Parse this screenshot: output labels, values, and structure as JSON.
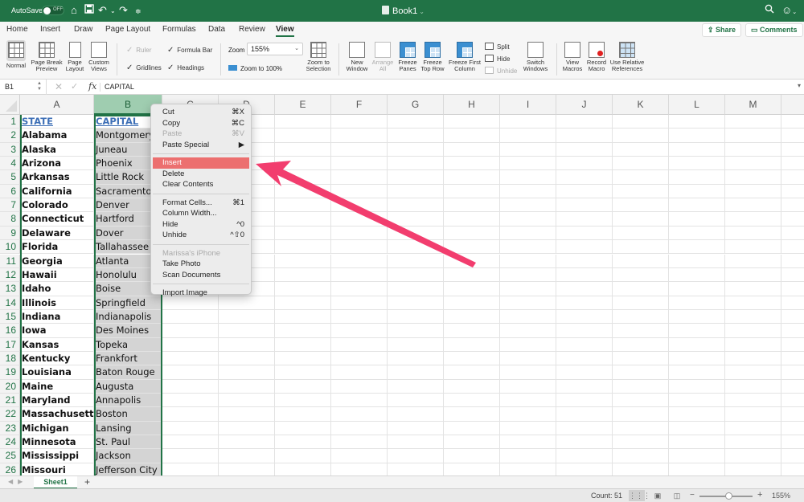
{
  "titlebar": {
    "autosave_label": "AutoSave",
    "autosave_state": "OFF",
    "doc_title": "Book1",
    "icons": [
      "home-icon",
      "save-icon",
      "undo-icon",
      "undo-dropdown-icon",
      "redo-icon",
      "customize-icon",
      "search-icon",
      "account-icon"
    ]
  },
  "tabs": [
    {
      "label": "Home",
      "active": false
    },
    {
      "label": "Insert",
      "active": false
    },
    {
      "label": "Draw",
      "active": false
    },
    {
      "label": "Page Layout",
      "active": false
    },
    {
      "label": "Formulas",
      "active": false
    },
    {
      "label": "Data",
      "active": false
    },
    {
      "label": "Review",
      "active": false
    },
    {
      "label": "View",
      "active": true
    }
  ],
  "share_label": "Share",
  "comments_label": "Comments",
  "ribbon": {
    "views": [
      {
        "label1": "Normal",
        "label2": "",
        "selected": true
      },
      {
        "label1": "Page Break",
        "label2": "Preview"
      },
      {
        "label1": "Page",
        "label2": "Layout"
      },
      {
        "label1": "Custom",
        "label2": "Views"
      }
    ],
    "show": {
      "ruler": {
        "label": "Ruler",
        "checked": true,
        "disabled": true
      },
      "formula_bar": {
        "label": "Formula Bar",
        "checked": true
      },
      "gridlines": {
        "label": "Gridlines",
        "checked": true
      },
      "headings": {
        "label": "Headings",
        "checked": true
      }
    },
    "zoom_label": "Zoom",
    "zoom_value": "155%",
    "zoom_100_label": "Zoom to 100%",
    "zoom_selection": {
      "label1": "Zoom to",
      "label2": "Selection"
    },
    "window": [
      {
        "label1": "New",
        "label2": "Window"
      },
      {
        "label1": "Arrange",
        "label2": "All",
        "disabled": true
      },
      {
        "label1": "Freeze",
        "label2": "Panes"
      },
      {
        "label1": "Freeze",
        "label2": "Top Row"
      },
      {
        "label1": "Freeze First",
        "label2": "Column"
      }
    ],
    "split_label": "Split",
    "hide_label": "Hide",
    "unhide_label": "Unhide",
    "switch_windows": {
      "label1": "Switch",
      "label2": "Windows"
    },
    "macros": [
      {
        "label1": "View",
        "label2": "Macros"
      },
      {
        "label1": "Record",
        "label2": "Macro"
      },
      {
        "label1": "Use Relative",
        "label2": "References"
      }
    ]
  },
  "formula_bar": {
    "name_box": "B1",
    "fx": "fx",
    "value": "CAPITAL"
  },
  "columns": [
    "A",
    "B",
    "C",
    "D",
    "E",
    "F",
    "G",
    "H",
    "I",
    "J",
    "K",
    "L",
    "M"
  ],
  "rows": [
    {
      "n": "1",
      "a": "STATE",
      "b": "CAPITAL"
    },
    {
      "n": "2",
      "a": "Alabama",
      "b": "Montgomery"
    },
    {
      "n": "3",
      "a": "Alaska",
      "b": "Juneau"
    },
    {
      "n": "4",
      "a": "Arizona",
      "b": "Phoenix"
    },
    {
      "n": "5",
      "a": "Arkansas",
      "b": "Little Rock"
    },
    {
      "n": "6",
      "a": "California",
      "b": "Sacramento"
    },
    {
      "n": "7",
      "a": "Colorado",
      "b": "Denver"
    },
    {
      "n": "8",
      "a": "Connecticut",
      "b": "Hartford"
    },
    {
      "n": "9",
      "a": "Delaware",
      "b": "Dover"
    },
    {
      "n": "10",
      "a": "Florida",
      "b": "Tallahassee"
    },
    {
      "n": "11",
      "a": "Georgia",
      "b": "Atlanta"
    },
    {
      "n": "12",
      "a": "Hawaii",
      "b": "Honolulu"
    },
    {
      "n": "13",
      "a": "Idaho",
      "b": "Boise"
    },
    {
      "n": "14",
      "a": "Illinois",
      "b": "Springfield"
    },
    {
      "n": "15",
      "a": "Indiana",
      "b": "Indianapolis"
    },
    {
      "n": "16",
      "a": "Iowa",
      "b": "Des Moines"
    },
    {
      "n": "17",
      "a": "Kansas",
      "b": "Topeka"
    },
    {
      "n": "18",
      "a": "Kentucky",
      "b": "Frankfort"
    },
    {
      "n": "19",
      "a": "Louisiana",
      "b": "Baton Rouge"
    },
    {
      "n": "20",
      "a": "Maine",
      "b": "Augusta"
    },
    {
      "n": "21",
      "a": "Maryland",
      "b": "Annapolis"
    },
    {
      "n": "22",
      "a": "Massachusetts",
      "b": "Boston"
    },
    {
      "n": "23",
      "a": "Michigan",
      "b": "Lansing"
    },
    {
      "n": "24",
      "a": "Minnesota",
      "b": "St. Paul"
    },
    {
      "n": "25",
      "a": "Mississippi",
      "b": "Jackson"
    },
    {
      "n": "26",
      "a": "Missouri",
      "b": "Jefferson City"
    }
  ],
  "context_menu": {
    "groups": [
      [
        {
          "label": "Cut",
          "shortcut": "⌘X"
        },
        {
          "label": "Copy",
          "shortcut": "⌘C"
        },
        {
          "label": "Paste",
          "shortcut": "⌘V",
          "disabled": true
        },
        {
          "label": "Paste Special",
          "shortcut": "▶"
        }
      ],
      [
        {
          "label": "Insert",
          "shortcut": "",
          "highlighted": true
        },
        {
          "label": "Delete",
          "shortcut": ""
        },
        {
          "label": "Clear Contents",
          "shortcut": ""
        }
      ],
      [
        {
          "label": "Format Cells...",
          "shortcut": "⌘1"
        },
        {
          "label": "Column Width...",
          "shortcut": ""
        },
        {
          "label": "Hide",
          "shortcut": "^0"
        },
        {
          "label": "Unhide",
          "shortcut": "^⇧0"
        }
      ],
      [
        {
          "label": "Marissa's iPhone",
          "shortcut": "",
          "disabled": true
        },
        {
          "label": "Take Photo",
          "shortcut": ""
        },
        {
          "label": "Scan Documents",
          "shortcut": ""
        }
      ],
      [
        {
          "label": "Import Image",
          "shortcut": ""
        }
      ]
    ]
  },
  "annotation": {
    "color": "#f23d6e",
    "points_to": "Insert"
  },
  "sheet_tabs": [
    {
      "label": "Sheet1",
      "active": true
    }
  ],
  "add_sheet_label": "+",
  "status": {
    "count": "Count: 51",
    "zoom_percent": "155%",
    "zoom_level_fraction": 0.55
  },
  "colors": {
    "brand": "#217346",
    "selection_fill": "#d4d4d4",
    "menu_highlight": "#ec6f6f",
    "header_link": "#3d6fb6"
  }
}
